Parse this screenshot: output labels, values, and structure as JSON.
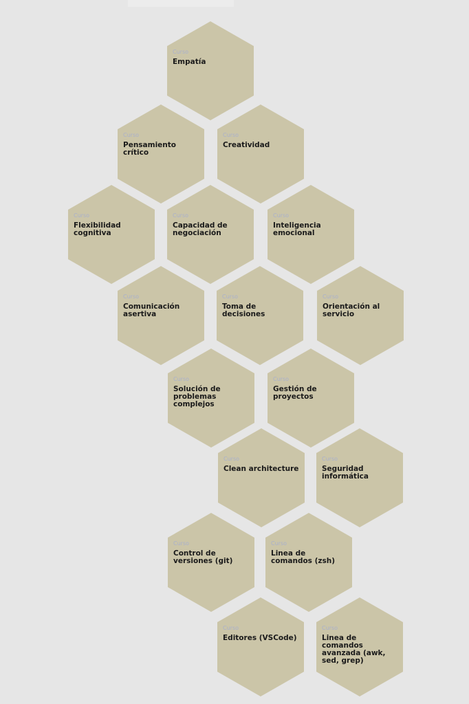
{
  "theme": {
    "hex_fill": "#cbc5a8",
    "kicker_color": "#a9b0cc"
  },
  "courses": [
    {
      "kicker": "Curso",
      "title": "Empatía"
    },
    {
      "kicker": "Curso",
      "title": "Pensamiento crítico"
    },
    {
      "kicker": "Curso",
      "title": "Creatividad"
    },
    {
      "kicker": "Curso",
      "title": "Flexibilidad cognitiva"
    },
    {
      "kicker": "Curso",
      "title": "Capacidad de negociación"
    },
    {
      "kicker": "Curso",
      "title": "Inteligencia emocional"
    },
    {
      "kicker": "Curso",
      "title": "Comunicación asertiva"
    },
    {
      "kicker": "Curso",
      "title": "Toma de decisiones"
    },
    {
      "kicker": "Curso",
      "title": "Orientación al servicio"
    },
    {
      "kicker": "Curso",
      "title": "Solución de problemas complejos"
    },
    {
      "kicker": "Curso",
      "title": "Gestión de proyectos"
    },
    {
      "kicker": "Curso",
      "title": "Clean architecture"
    },
    {
      "kicker": "Curso",
      "title": "Seguridad informática"
    },
    {
      "kicker": "Curso",
      "title": "Control de versiones (git)"
    },
    {
      "kicker": "Curso",
      "title": "Linea de comandos (zsh)"
    },
    {
      "kicker": "Curso",
      "title": "Editores (VSCode)"
    },
    {
      "kicker": "Curso",
      "title": "Linea de comandos avanzada (awk, sed, grep)"
    }
  ]
}
